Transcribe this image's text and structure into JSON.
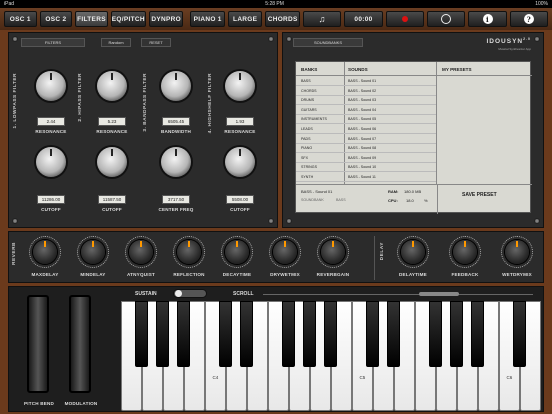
{
  "status": {
    "device": "iPad",
    "time": "5:28 PM",
    "battery": "100%"
  },
  "topbar": {
    "tabs": [
      "OSC 1",
      "OSC 2",
      "FILTERS",
      "EQ/PITCH",
      "DYNPRO",
      "PIANO 1",
      "LARGE",
      "CHORDS"
    ],
    "active": "FILTERS",
    "music_glyph": "♫",
    "timer": "00:00",
    "info_glyph": "i",
    "help_glyph": "?"
  },
  "filters": {
    "header": "FILTERS",
    "random": "Random",
    "reset": "RESET",
    "sections": [
      {
        "name": "1. LOWPASS FILTER",
        "top_value": "2.44",
        "top_label": "RESONANCE",
        "bottom_value": "11286.00",
        "bottom_label": "CUTOFF"
      },
      {
        "name": "2. HIPASS FILTER",
        "top_value": "5.23",
        "top_label": "RESONANCE",
        "bottom_value": "11587.50",
        "bottom_label": "CUTOFF"
      },
      {
        "name": "3. BANDPASS FILTER",
        "top_value": "6505.45",
        "top_label": "BANDWIDTH",
        "bottom_value": "3717.50",
        "bottom_label": "CENTER FREQ"
      },
      {
        "name": "4. HIGHSHELF FILTER",
        "top_value": "1.93",
        "top_label": "RESONANCE",
        "bottom_value": "5508.00",
        "bottom_label": "CUTOFF"
      }
    ]
  },
  "soundbanks": {
    "header": "SOUNDBANKS",
    "logo": "IDOUSYN",
    "logo_version": "2.0",
    "logo_sub": "Musical Synthesizer App",
    "col_banks": "BANKS",
    "col_sounds": "SOUNDS",
    "col_presets": "MY PRESETS",
    "banks": [
      "BASS",
      "CHORDS",
      "DRUMS",
      "GUITARS",
      "INSTRUMENTS",
      "LEADS",
      "PADS",
      "PIANO",
      "SFX",
      "STRINGS",
      "SYNTH"
    ],
    "sounds": [
      "BASS - Sound 01",
      "BASS - Sound 02",
      "BASS - Sound 03",
      "BASS - Sound 04",
      "BASS - Sound 05",
      "BASS - Sound 06",
      "BASS - Sound 07",
      "BASS - Sound 08",
      "BASS - Sound 09",
      "BASS - Sound 10",
      "BASS - Sound 11"
    ],
    "current": "BASS - Sound 01",
    "current_bank_label": "SOUNDBANK",
    "current_bank": "BASS",
    "ram_label": "RAM:",
    "ram_value": "180.0 MB",
    "cpu_label": "CPU:",
    "cpu_value": "18.0",
    "cpu_unit": "%",
    "save": "SAVE PRESET"
  },
  "reverb": {
    "side": "REVERB",
    "knobs": [
      "MAXDELAY",
      "MINDELAY",
      "ATNYQUIST",
      "REFLECTION",
      "DECAYTIME",
      "DRYWETMIX",
      "REVERBGAIN"
    ]
  },
  "delay": {
    "side": "DELAY",
    "knobs": [
      "DELAYTIME",
      "FEEDBACK",
      "WETDRYMIX"
    ]
  },
  "keyboard": {
    "sustain": "SUSTAIN",
    "scroll": "SCROLL",
    "pitch_bend": "PITCH BEND",
    "modulation": "MODULATION",
    "octave_labels": [
      "C4",
      "C5",
      "C6"
    ]
  },
  "colors": {
    "wood": "#6b3a1c",
    "panel": "#2b2b2b",
    "record": "#dd1111",
    "knob_accent": "#ff9900"
  }
}
